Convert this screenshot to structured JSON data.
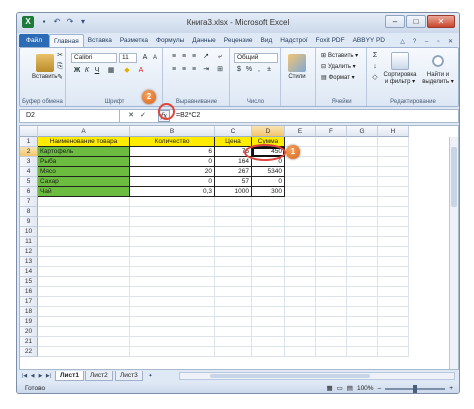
{
  "window": {
    "title": "Книга3.xlsx - Microsoft Excel",
    "logo": "X"
  },
  "tabs": {
    "file": "Файл",
    "items": [
      "Главная",
      "Вставка",
      "Разметка",
      "Формулы",
      "Данные",
      "Рецензие",
      "Вид",
      "Надстрої",
      "Foxit PDF",
      "ABBYY PD"
    ]
  },
  "ribbon": {
    "paste_label": "Вставить",
    "clipboard_label": "Буфер обмена",
    "font_name": "Calibri",
    "font_size": "11",
    "font_label": "Шрифт",
    "align_label": "Выравнивание",
    "number_format": "Общий",
    "number_label": "Число",
    "styles_label": "Стили",
    "insert_label": "Вставить ▾",
    "delete_label": "Удалить ▾",
    "format_label": "Формат ▾",
    "cells_label": "Ячейки",
    "sort_label": "Сортировка и фильтр ▾",
    "find_label": "Найти и выделить ▾",
    "editing_label": "Редактирование"
  },
  "formula_bar": {
    "name_box": "D2",
    "fx": "fx",
    "formula": "=B2*C2"
  },
  "grid": {
    "columns": [
      "A",
      "B",
      "C",
      "D",
      "E",
      "F",
      "G",
      "H"
    ],
    "rows": [
      "1",
      "2",
      "3",
      "4",
      "5",
      "6",
      "7",
      "8",
      "9",
      "10",
      "11",
      "12",
      "13",
      "14",
      "15",
      "16",
      "17",
      "18",
      "19",
      "20",
      "21",
      "22"
    ],
    "headers": [
      "Наименование товара",
      "Количество",
      "Цена",
      "Сумма"
    ],
    "data": [
      [
        "Картофель",
        "6",
        "75",
        "450"
      ],
      [
        "Рыба",
        "0",
        "164",
        "0"
      ],
      [
        "Мясо",
        "20",
        "267",
        "5340"
      ],
      [
        "Сахар",
        "0",
        "57",
        "0"
      ],
      [
        "Чай",
        "0,3",
        "1000",
        "300"
      ]
    ],
    "colors": {
      "header": "#ffeb00",
      "name_column": "#6cbd3f"
    }
  },
  "sheets": {
    "tabs": [
      "Лист1",
      "Лист2",
      "Лист3"
    ],
    "active": "Лист1"
  },
  "status": {
    "ready": "Готово",
    "zoom": "100%"
  },
  "callouts": [
    "1",
    "2"
  ]
}
